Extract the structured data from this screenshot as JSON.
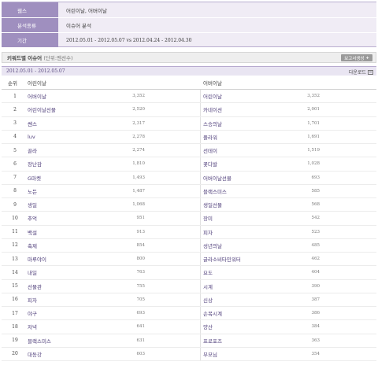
{
  "info": {
    "rows": [
      {
        "label": "웹스",
        "value": "어린이날, 어버이날"
      },
      {
        "label": "분석종류",
        "value": "이슈어 분석"
      },
      {
        "label": "기간",
        "value": "2012.05.01 - 2012.05.07 vs 2012.04.24 - 2012.04.30"
      }
    ]
  },
  "section": {
    "title": "키워드별 이슈어",
    "unit": "(단위:멘션수)",
    "report_button": "보고서생성",
    "report_plus": "+"
  },
  "date_bar": {
    "date": "2012.05.01 - 2012.05.07",
    "download": "다운로드"
  },
  "table": {
    "headers": {
      "rank": "순위",
      "col1": "어린이날",
      "col2": "어버이날"
    },
    "rows": [
      {
        "rank": "1",
        "kw1": "어버이날",
        "v1": "3,352",
        "kw2": "어린이날",
        "v2": "3,352"
      },
      {
        "rank": "2",
        "kw1": "어린이날선물",
        "v1": "2,520",
        "kw2": "카네이션",
        "v2": "2,001"
      },
      {
        "rank": "3",
        "kw1": "쎈스",
        "v1": "2,317",
        "kw2": "스승의날",
        "v2": "1,701"
      },
      {
        "rank": "4",
        "kw1": "luv",
        "v1": "2,278",
        "kw2": "플라워",
        "v2": "1,691"
      },
      {
        "rank": "5",
        "kw1": "골라",
        "v1": "2,274",
        "kw2": "선데이",
        "v2": "1,519"
      },
      {
        "rank": "6",
        "kw1": "장난감",
        "v1": "1,810",
        "kw2": "꽃다발",
        "v2": "1,028"
      },
      {
        "rank": "7",
        "kw1": "G마켓",
        "v1": "1,493",
        "kw2": "어버이날선물",
        "v2": "693"
      },
      {
        "rank": "8",
        "kw1": "노든",
        "v1": "1,487",
        "kw2": "블랙스미스",
        "v2": "585"
      },
      {
        "rank": "9",
        "kw1": "생일",
        "v1": "1,068",
        "kw2": "생일선물",
        "v2": "568"
      },
      {
        "rank": "10",
        "kw1": "추억",
        "v1": "951",
        "kw2": "장미",
        "v2": "542"
      },
      {
        "rank": "11",
        "kw1": "백설",
        "v1": "913",
        "kw2": "피자",
        "v2": "523"
      },
      {
        "rank": "12",
        "kw1": "축제",
        "v1": "854",
        "kw2": "성년의날",
        "v2": "485"
      },
      {
        "rank": "13",
        "kw1": "마루야이",
        "v1": "800",
        "kw2": "글라소비타민워터",
        "v2": "462"
      },
      {
        "rank": "14",
        "kw1": "내일",
        "v1": "763",
        "kw2": "요도",
        "v2": "404"
      },
      {
        "rank": "15",
        "kw1": "선물관",
        "v1": "755",
        "kw2": "시계",
        "v2": "390"
      },
      {
        "rank": "16",
        "kw1": "피자",
        "v1": "705",
        "kw2": "신상",
        "v2": "387"
      },
      {
        "rank": "17",
        "kw1": "야구",
        "v1": "693",
        "kw2": "손목시계",
        "v2": "386"
      },
      {
        "rank": "18",
        "kw1": "저녁",
        "v1": "641",
        "kw2": "양산",
        "v2": "384"
      },
      {
        "rank": "19",
        "kw1": "블랙스미스",
        "v1": "631",
        "kw2": "프로포즈",
        "v2": "363"
      },
      {
        "rank": "20",
        "kw1": "대동강",
        "v1": "603",
        "kw2": "부모님",
        "v2": "354"
      }
    ]
  }
}
